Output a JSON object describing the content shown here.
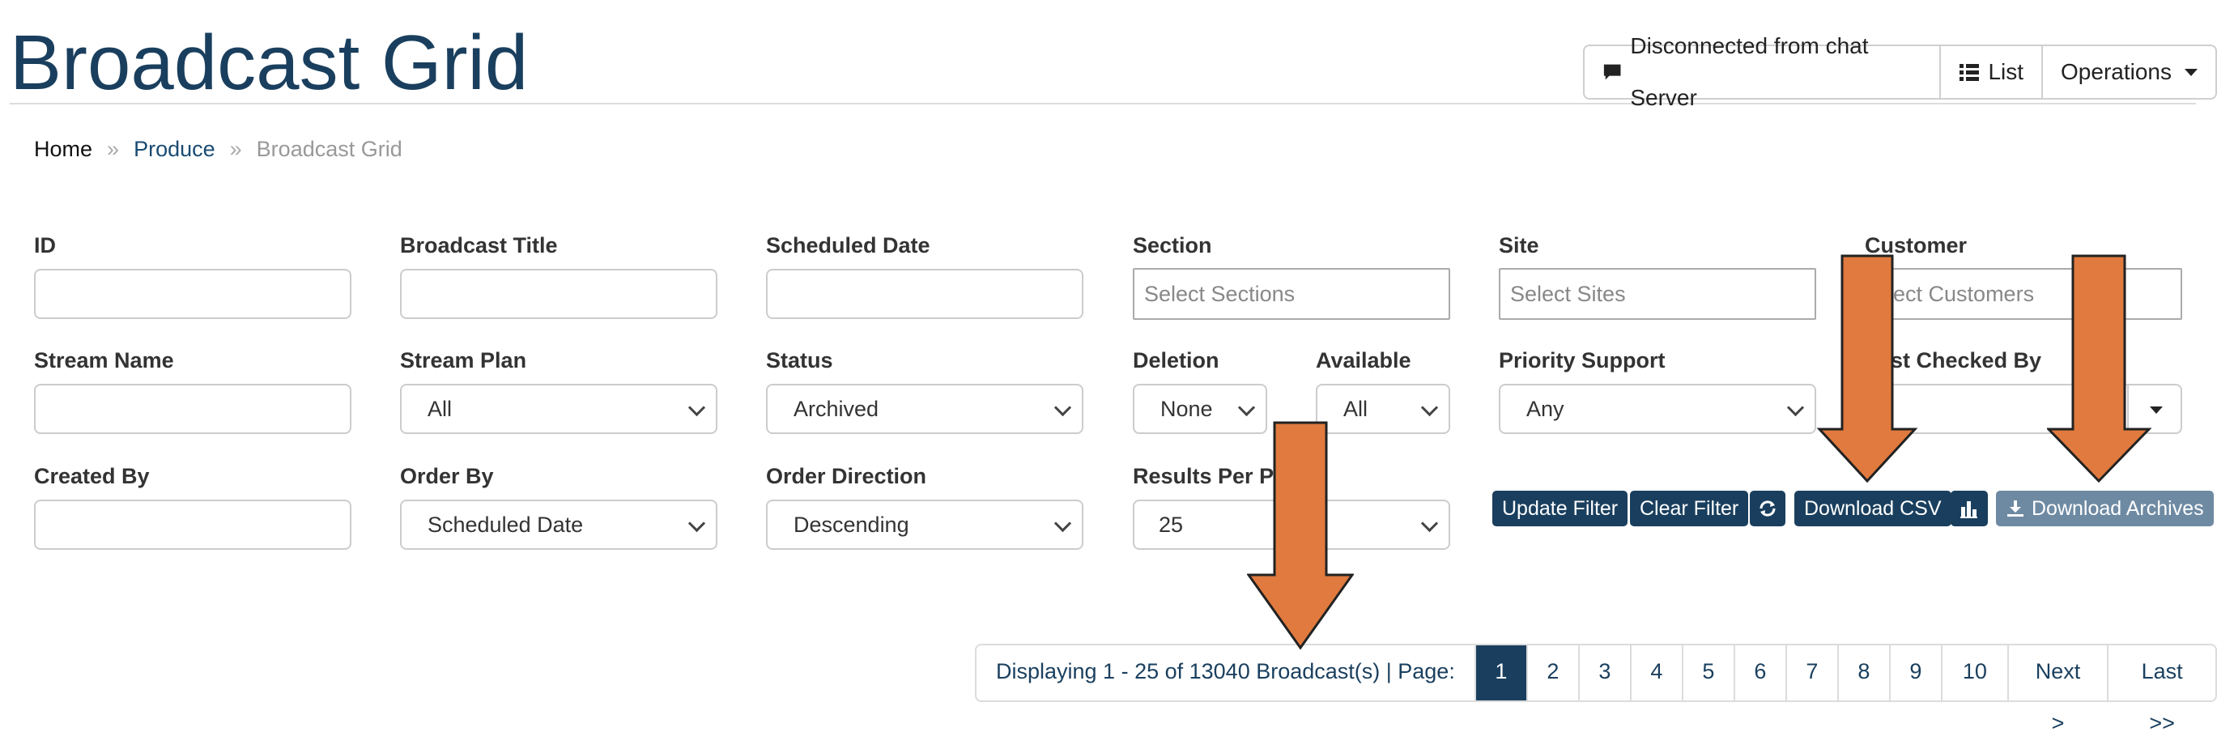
{
  "page": {
    "title": "Broadcast Grid"
  },
  "header": {
    "chat_status": "Disconnected from chat Server",
    "list_label": "List",
    "operations_label": "Operations"
  },
  "breadcrumb": {
    "home": "Home",
    "produce": "Produce",
    "current": "Broadcast Grid",
    "separator": "»"
  },
  "filters": {
    "id": {
      "label": "ID",
      "value": ""
    },
    "broadcast_title": {
      "label": "Broadcast Title",
      "value": ""
    },
    "scheduled_date": {
      "label": "Scheduled Date",
      "value": ""
    },
    "section": {
      "label": "Section",
      "placeholder": "Select Sections"
    },
    "site": {
      "label": "Site",
      "placeholder": "Select Sites"
    },
    "customer": {
      "label": "Customer",
      "placeholder": "elect Customers"
    },
    "stream_name": {
      "label": "Stream Name",
      "value": ""
    },
    "stream_plan": {
      "label": "Stream Plan",
      "value": "All"
    },
    "status": {
      "label": "Status",
      "value": "Archived"
    },
    "deletion": {
      "label": "Deletion",
      "value": "None"
    },
    "available": {
      "label": "Available",
      "value": "All"
    },
    "priority_support": {
      "label": "Priority Support",
      "value": "Any"
    },
    "last_checked_by": {
      "label": "st Checked By",
      "value": ""
    },
    "created_by": {
      "label": "Created By",
      "value": ""
    },
    "order_by": {
      "label": "Order By",
      "value": "Scheduled Date"
    },
    "order_direction": {
      "label": "Order Direction",
      "value": "Descending"
    },
    "results_per_page": {
      "label": "Results Per Pa",
      "value": "25"
    }
  },
  "actions": {
    "update_filter": "Update Filter",
    "clear_filter": "Clear Filter",
    "download_csv": "Download CSV",
    "download_archives": "Download Archives"
  },
  "pagination": {
    "info": "Displaying 1 - 25 of 13040 Broadcast(s) | Page:",
    "pages": [
      "1",
      "2",
      "3",
      "4",
      "5",
      "6",
      "7",
      "8",
      "9",
      "10"
    ],
    "next": "Next >",
    "last": "Last >>"
  },
  "colors": {
    "brand": "#1a3f5e",
    "arrow_fill": "#e07a3e",
    "arrow_stroke": "#222222"
  }
}
